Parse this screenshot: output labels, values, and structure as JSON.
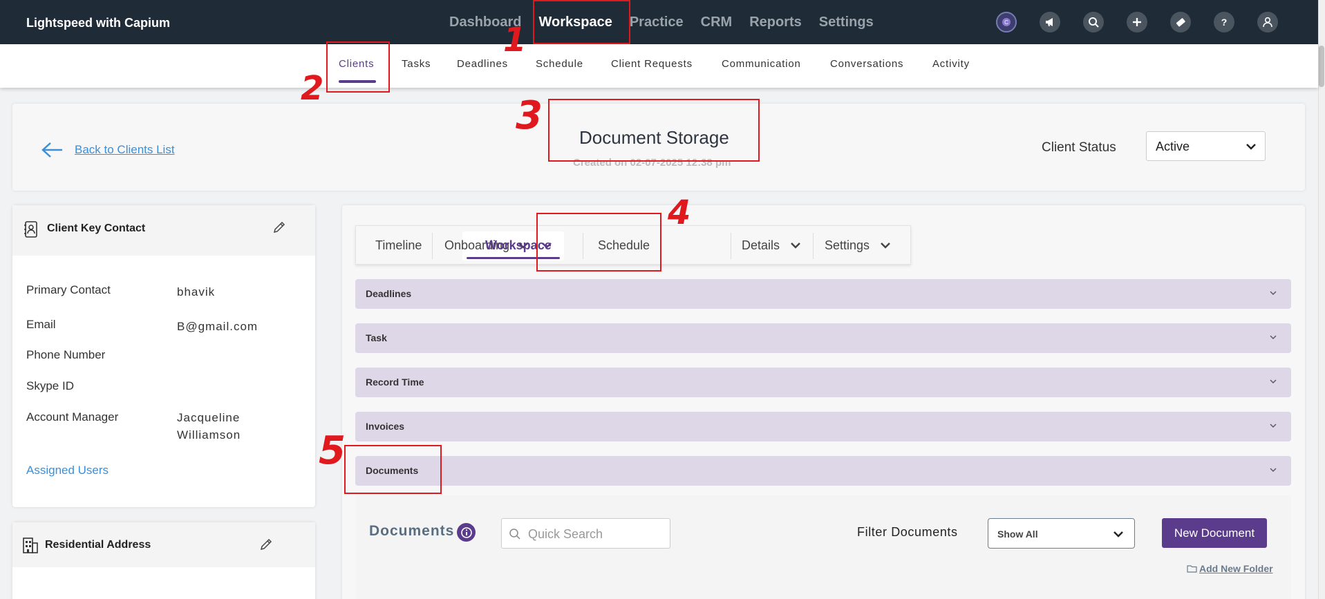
{
  "topnav": {
    "brand": "Lightspeed with Capium",
    "items": [
      "Dashboard",
      "Workspace",
      "Practice",
      "CRM",
      "Reports",
      "Settings"
    ],
    "icons": [
      "app-logo-icon",
      "megaphone-icon",
      "search-icon",
      "plus-icon",
      "ticket-icon",
      "help-icon",
      "user-icon"
    ]
  },
  "subnav": {
    "tabs": [
      "Clients",
      "Tasks",
      "Deadlines",
      "Schedule",
      "Client Requests",
      "Communication",
      "Conversations",
      "Activity"
    ]
  },
  "header": {
    "back_link": "Back to Clients List",
    "title": "Document Storage",
    "created": "Created on 02-07-2025 12:38 pm",
    "status_label": "Client Status",
    "status_value": "Active"
  },
  "client_key_contact": {
    "title": "Client Key Contact",
    "rows": [
      {
        "label": "Primary Contact",
        "value": "bhavik"
      },
      {
        "label": "Email",
        "value": "B@gmail.com"
      },
      {
        "label": "Phone Number",
        "value": ""
      },
      {
        "label": "Skype ID",
        "value": ""
      },
      {
        "label": "Account Manager",
        "value": "Jacqueline",
        "value2": "Williamson"
      }
    ],
    "assigned_users": "Assigned Users"
  },
  "residential_address": {
    "title": "Residential Address"
  },
  "client_tabs": [
    "Timeline",
    "Onboarding",
    "Workspace",
    "Schedule",
    "Details",
    "Settings"
  ],
  "accordions": [
    "Deadlines",
    "Task",
    "Record Time",
    "Invoices",
    "Documents"
  ],
  "documents": {
    "heading": "Documents",
    "search_placeholder": "Quick Search",
    "filter_label": "Filter Documents",
    "filter_value": "Show All",
    "new_button": "New Document",
    "add_folder": "Add New Folder"
  },
  "annotations": [
    "1",
    "2",
    "3",
    "4",
    "5"
  ],
  "colors": {
    "accent": "#5b3b8c",
    "topbar": "#1f2b36",
    "accordion": "#ded7e8",
    "annotation": "#e0191e",
    "link": "#3a8fd8"
  }
}
